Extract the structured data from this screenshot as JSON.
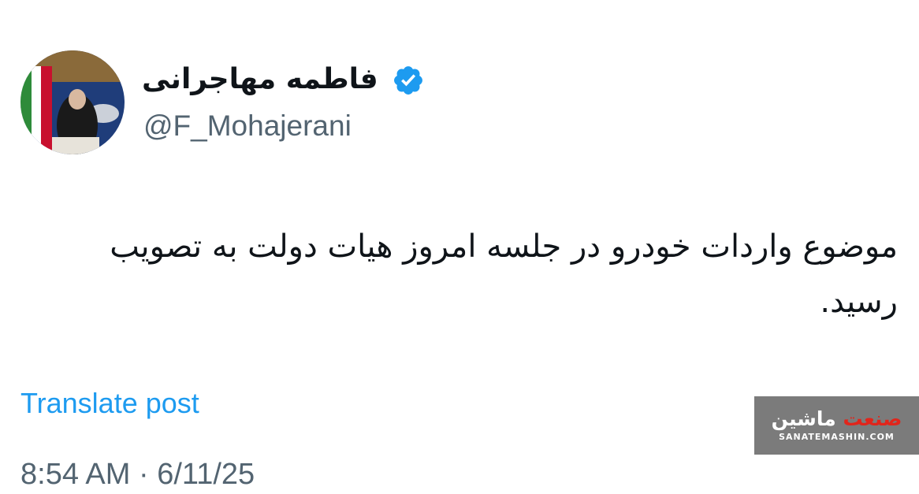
{
  "profile": {
    "display_name": "فاطمه مهاجرانی",
    "handle": "@F_Mohajerani",
    "verified_icon": "verified-badge-icon",
    "avatar_icon": "profile-photo"
  },
  "post": {
    "text": "موضوع واردات خودرو در جلسه امروز هیات دولت به تصویب رسید.",
    "translate_label": "Translate post",
    "timestamp": "8:54 AM · 6/11/25"
  },
  "watermark": {
    "title_red": "صنعت",
    "title_white": "ماشین",
    "url": "SANATEMASHIN.COM"
  },
  "colors": {
    "text_primary": "#0f1419",
    "text_secondary": "#536471",
    "link": "#1d9bf0",
    "verified": "#1d9bf0",
    "watermark_bg": "#7b7b7b",
    "watermark_accent": "#e1251b"
  }
}
